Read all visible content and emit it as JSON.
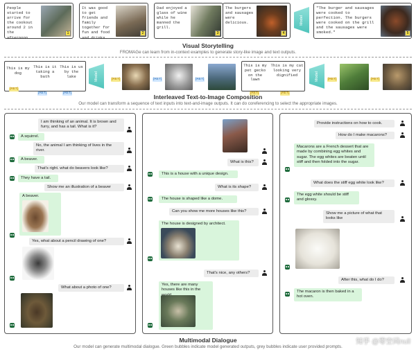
{
  "visual_storytelling": {
    "title": "Visual Storytelling",
    "caption": "FROMAGe can learn from in-context examples to generate story-like image and text outputs.",
    "story_texts": [
      "People started to arrive for the cookout around 2 in the afternoon.",
      "It was good to get friends and family together for fun and food and drinks.",
      "Dad enjoyed a glass of wine while he manned the grill.",
      "The burgers and sausages were delicious."
    ],
    "image_numbers": [
      "1",
      "2",
      "3",
      "4",
      "5"
    ],
    "model_label": "Model",
    "output_text": "\"The burger and sausages were cooked to perfection. The burgers were cooked on the grill and the sausages were smoked.\""
  },
  "interleaved": {
    "title": "Interleaved Text-to-Image Composition",
    "caption": "Our model can transform a sequence of text inputs into text-and-image outputs. It can do coreferencing to select the appropriate images.",
    "input_texts": [
      "This is my dog",
      "This is it taking a bath",
      "This is us by the lake"
    ],
    "input_texts_2": [
      "This is my pet gecko on the lawn",
      "This is my cat looking very dignified"
    ],
    "ret_label": "[RET]",
    "model_label": "Model"
  },
  "dialogue": {
    "title": "Multimodal Dialogue",
    "caption": "Our model can generate multimodal dialogue. Green bubbles indicate model generated outputs, grey bubbles indicate user provided prompts.",
    "panel1": [
      "I am thinking of an animal. It is brown and furry, and has a tail. What is it?",
      "A squirrel.",
      "No, the animal I am thinking of lives in the river.",
      "A beaver.",
      "That's right. what do beavers look like?",
      "They have a tail.",
      "Show me an illustration of a beaver",
      "A beaver.",
      "Yes, what about a pencil drawing of one?",
      "What about a photo of one?"
    ],
    "panel2": [
      "What is this?",
      "This is a house with a unique design.",
      "What is its shape?",
      "The house is shaped like a dome.",
      "Can you show me more houses like this?",
      "The house is designed by architect.",
      "That's nice, any others?",
      "Yes, there are many houses like this in the world."
    ],
    "panel3": [
      "Provide instructions on how to cook.",
      "How do I make macarons?",
      "Macarons are a French dessert that are made by combining egg whites and sugar. The egg whites are beaten until stiff and then folded into the sugar.",
      "What does the stiff egg white look like?",
      "The egg white should be stiff and glossy.",
      "Show me a picture of what that looks like",
      "After this, what do I do?",
      "The macaron is then baked in a hot oven."
    ]
  },
  "watermark": "知乎 @零空间null"
}
